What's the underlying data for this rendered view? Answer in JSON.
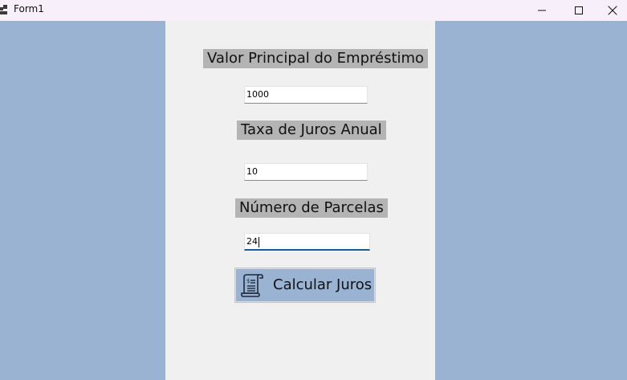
{
  "window": {
    "title": "Form1"
  },
  "form": {
    "principal_label": "Valor Principal do Empréstimo",
    "principal_value": "1000",
    "rate_label": "Taxa de Juros Anual",
    "rate_value": "10",
    "installments_label": "Número de Parcelas",
    "installments_value": "24",
    "calculate_button": "Calcular Juros"
  },
  "icons": {
    "app": "app-icon",
    "minimize": "minimize-icon",
    "maximize": "maximize-icon",
    "close": "close-icon",
    "calculate": "receipt-scroll-icon"
  },
  "colors": {
    "background": "#9ab3d2",
    "panel": "#f0f0f0",
    "label_bg": "#b4b4b4",
    "focus_accent": "#1c5a96"
  }
}
